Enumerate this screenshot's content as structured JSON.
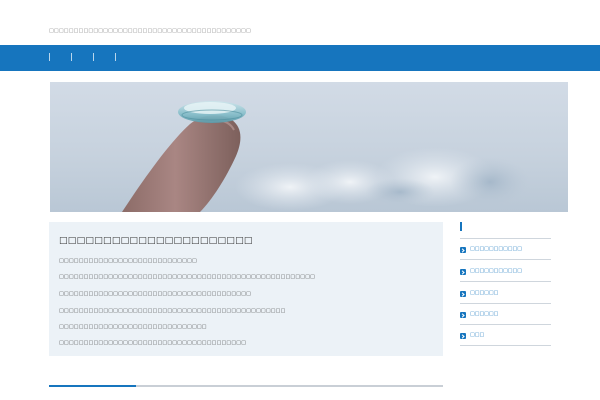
{
  "header": {
    "tagline": "□□□□□□□□□□□□□□□□□□□□□□□□□□□□□□□□□□□□□□□□□"
  },
  "nav": {
    "items": [
      "",
      "",
      "",
      ""
    ]
  },
  "hero": {
    "icon": "contact-lens-on-fingertip-photo"
  },
  "article": {
    "title": "□□□□□□□□□□□□□□□□□□□□□□",
    "lines": [
      "□□□□□□□□□□□□□□□□□□□□□□□□□□□□",
      "□□□□□□□□□□□□□□□□□□□□□□□□□□□□□□□□□□□□□□□□□□□□□□□□□□□□",
      "□□□□□□□□□□□□□□□□□□□□□□□□□□□□□□□□□□□□□□□",
      "□□□□□□□□□□□□□□□□□□□□□□□□□□□□□□□□□□□□□□□□□□□□□□",
      "□□□□□□□□□□□□□□□□□□□□□□□□□□□□□□",
      "□□□□□□□□□□□□□□□□□□□□□□□□□□□□□□□□□□□□□□"
    ]
  },
  "sidebar": {
    "heading": "",
    "items": [
      {
        "label": "□□□□□□□□□□□"
      },
      {
        "label": "□□□□□□□□□□□"
      },
      {
        "label": "□□□□□□"
      },
      {
        "label": "□□□□□□"
      },
      {
        "label": "□□□"
      }
    ]
  },
  "colors": {
    "brand": "#1675be",
    "panel": "#ecf2f7"
  }
}
